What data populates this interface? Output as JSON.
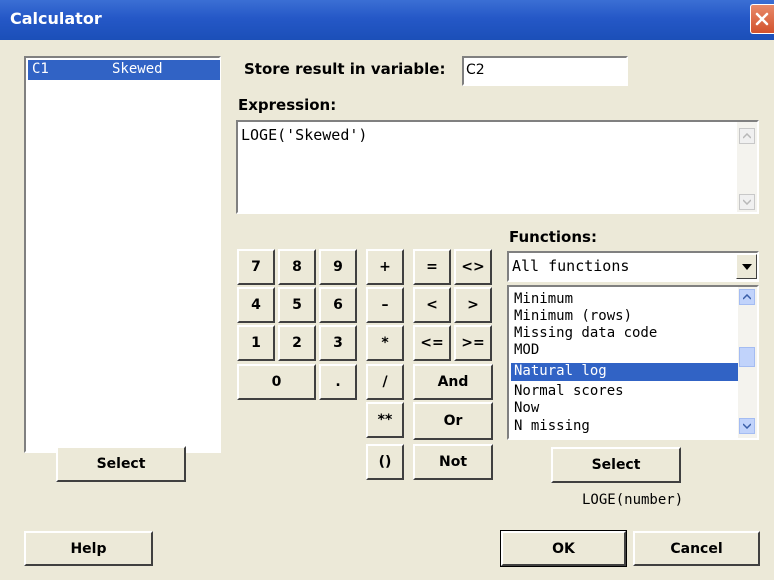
{
  "window": {
    "title": "Calculator"
  },
  "variables": {
    "items": [
      {
        "id": "C1",
        "name": "Skewed"
      }
    ]
  },
  "store": {
    "label": "Store result in variable:",
    "value": "C2"
  },
  "expression": {
    "label": "Expression:",
    "value": "LOGE('Skewed')"
  },
  "keypad": {
    "digits": [
      "7",
      "8",
      "9",
      "4",
      "5",
      "6",
      "1",
      "2",
      "3",
      "0",
      "."
    ],
    "ops": [
      "+",
      "–",
      "*",
      "/",
      "**",
      "()"
    ],
    "compare": [
      "=",
      "<>",
      "<",
      ">",
      "<=",
      ">="
    ],
    "logic": [
      "And",
      "Or",
      "Not"
    ]
  },
  "functions": {
    "label": "Functions:",
    "category": "All functions",
    "items": [
      "Minimum",
      "Minimum (rows)",
      "Missing data code",
      "MOD",
      "Natural log",
      "Normal scores",
      "Now",
      "N missing"
    ],
    "selected": "Natural log",
    "signature": "LOGE(number)"
  },
  "buttons": {
    "select_left": "Select",
    "select_right": "Select",
    "help": "Help",
    "ok": "OK",
    "cancel": "Cancel"
  },
  "icons": {
    "close": "close-icon",
    "dropdown": "chevron-down-icon",
    "scroll_up": "arrow-up-icon",
    "scroll_down": "arrow-down-icon"
  }
}
